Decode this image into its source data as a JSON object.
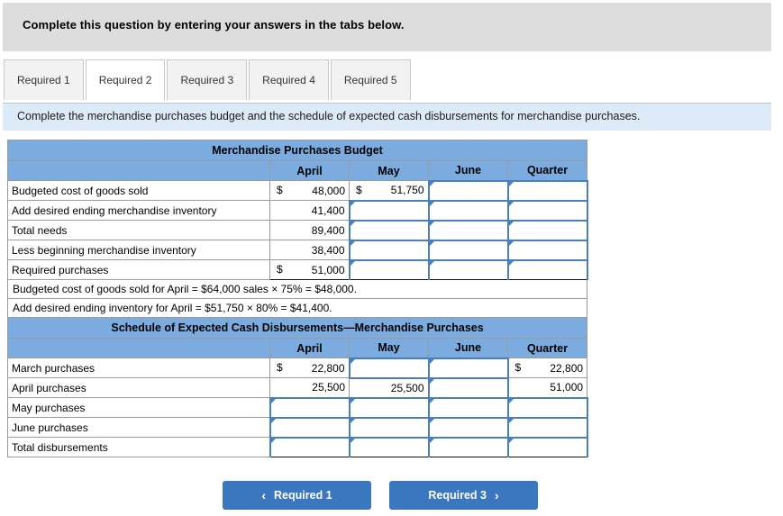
{
  "header": {
    "instruction": "Complete this question by entering your answers in the tabs below."
  },
  "tabs": [
    {
      "label": "Required 1",
      "active": false
    },
    {
      "label": "Required 2",
      "active": true
    },
    {
      "label": "Required 3",
      "active": false
    },
    {
      "label": "Required 4",
      "active": false
    },
    {
      "label": "Required 5",
      "active": false
    }
  ],
  "sub_instruction": "Complete the merchandise purchases budget and the schedule of expected cash disbursements for merchandise purchases.",
  "budget_table": {
    "title": "Merchandise Purchases Budget",
    "columns": [
      "April",
      "May",
      "June",
      "Quarter"
    ],
    "rows": [
      {
        "label": "Budgeted cost of goods sold",
        "april": {
          "currency": "$",
          "value": "48,000"
        },
        "may": {
          "currency": "$",
          "value": "51,750"
        },
        "june": {
          "value": ""
        },
        "quarter": {
          "value": ""
        }
      },
      {
        "label": "Add desired ending merchandise inventory",
        "april": {
          "currency": "",
          "value": "41,400"
        },
        "may": {
          "value": ""
        },
        "june": {
          "value": ""
        },
        "quarter": {
          "value": ""
        }
      },
      {
        "label": "Total needs",
        "april": {
          "currency": "",
          "value": "89,400"
        },
        "may": {
          "value": ""
        },
        "june": {
          "value": ""
        },
        "quarter": {
          "value": ""
        }
      },
      {
        "label": "Less beginning merchandise inventory",
        "april": {
          "currency": "",
          "value": "38,400"
        },
        "may": {
          "value": ""
        },
        "june": {
          "value": ""
        },
        "quarter": {
          "value": ""
        }
      },
      {
        "label": "Required purchases",
        "april": {
          "currency": "$",
          "value": "51,000"
        },
        "may": {
          "value": ""
        },
        "june": {
          "value": ""
        },
        "quarter": {
          "value": ""
        }
      }
    ]
  },
  "notes": [
    "Budgeted cost of goods sold for April = $64,000 sales × 75% = $48,000.",
    "Add desired ending inventory for April = $51,750 × 80% = $41,400."
  ],
  "disbursements_table": {
    "title": "Schedule of Expected Cash Disbursements—Merchandise Purchases",
    "columns": [
      "April",
      "May",
      "June",
      "Quarter"
    ],
    "rows": [
      {
        "label": "March purchases",
        "april": {
          "currency": "$",
          "value": "22,800"
        },
        "may": {
          "value": ""
        },
        "june": {
          "value": ""
        },
        "quarter": {
          "currency": "$",
          "value": "22,800"
        }
      },
      {
        "label": "April purchases",
        "april": {
          "currency": "",
          "value": "25,500"
        },
        "may": {
          "currency": "",
          "value": "25,500"
        },
        "june": {
          "value": ""
        },
        "quarter": {
          "currency": "",
          "value": "51,000"
        }
      },
      {
        "label": "May purchases",
        "april": {
          "value": ""
        },
        "may": {
          "value": ""
        },
        "june": {
          "value": ""
        },
        "quarter": {
          "value": ""
        }
      },
      {
        "label": "June purchases",
        "april": {
          "value": ""
        },
        "may": {
          "value": ""
        },
        "june": {
          "value": ""
        },
        "quarter": {
          "value": ""
        }
      },
      {
        "label": "Total disbursements",
        "april": {
          "value": ""
        },
        "may": {
          "value": ""
        },
        "june": {
          "value": ""
        },
        "quarter": {
          "value": ""
        }
      }
    ]
  },
  "nav": {
    "prev_label": "Required 1",
    "next_label": "Required 3",
    "prev_chevron": "‹",
    "next_chevron": "›"
  },
  "colors": {
    "header_blue": "#7cacdf",
    "input_border_blue": "#4a7fbd",
    "button_blue": "#3a77bf",
    "band_gray": "#dddddd",
    "band_light_blue": "#dcebf7"
  }
}
